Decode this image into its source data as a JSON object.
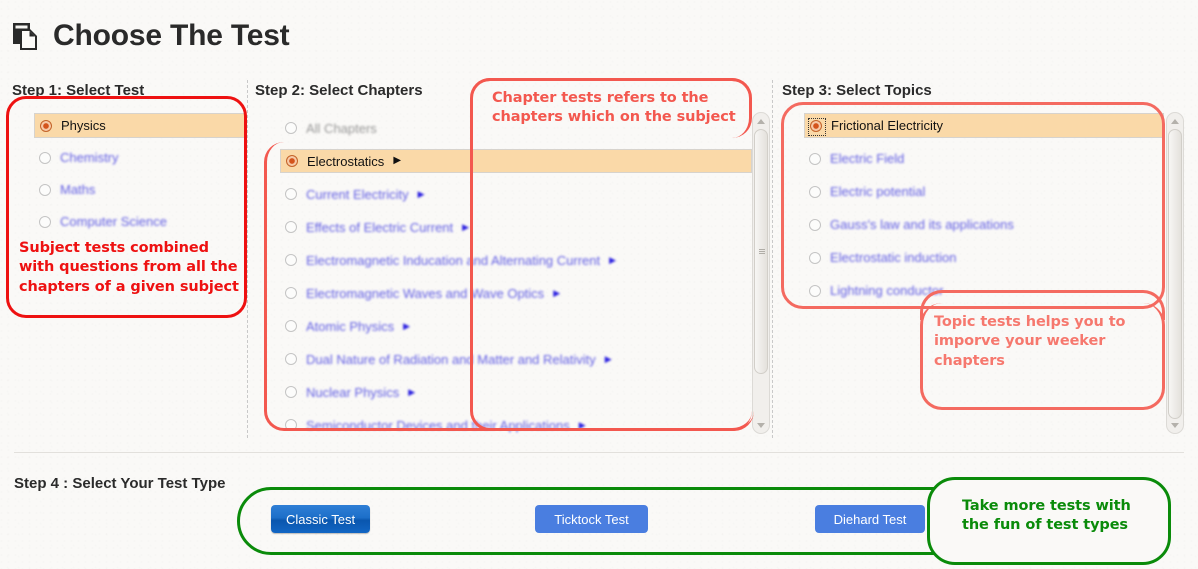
{
  "header": {
    "title": "Choose The Test",
    "icon": "pages-icon"
  },
  "steps": {
    "step1_label": "Step 1: Select Test",
    "step2_label": "Step 2: Select Chapters",
    "step3_label": "Step 3: Select Topics",
    "step4_label": "Step 4 : Select Your Test Type"
  },
  "subjects": [
    {
      "label": "Physics",
      "selected": true,
      "muted": true
    },
    {
      "label": "Chemistry",
      "selected": false,
      "muted": true
    },
    {
      "label": "Maths",
      "selected": false,
      "muted": true
    },
    {
      "label": "Computer Science",
      "selected": false,
      "muted": true
    }
  ],
  "chapters": [
    {
      "label": "All Chapters",
      "selected": false,
      "gray": true,
      "arrow": false
    },
    {
      "label": "Electrostatics",
      "selected": true,
      "arrow": true
    },
    {
      "label": "Current Electricity",
      "selected": false,
      "arrow": true
    },
    {
      "label": "Effects of Electric Current",
      "selected": false,
      "arrow": true
    },
    {
      "label": "Electromagnetic Inducation and Alternating Current",
      "selected": false,
      "arrow": true
    },
    {
      "label": "Electromagnetic Waves and Wave Optics",
      "selected": false,
      "arrow": true
    },
    {
      "label": "Atomic Physics",
      "selected": false,
      "arrow": true
    },
    {
      "label": "Dual Nature of Radiation and Matter and Relativity",
      "selected": false,
      "arrow": true
    },
    {
      "label": "Nuclear Physics",
      "selected": false,
      "arrow": true
    },
    {
      "label": "Semiconductor Devices and their Applications",
      "selected": false,
      "arrow": true
    }
  ],
  "topics": [
    {
      "label": "Frictional Electricity",
      "selected": true
    },
    {
      "label": "Electric Field",
      "selected": false
    },
    {
      "label": "Electric potential",
      "selected": false
    },
    {
      "label": "Gauss's law and its applications",
      "selected": false
    },
    {
      "label": "Electrostatic induction",
      "selected": false
    },
    {
      "label": "Lightning conductor",
      "selected": false
    }
  ],
  "test_types": [
    {
      "label": "Classic Test",
      "style": "primary"
    },
    {
      "label": "Ticktock Test",
      "style": "secondary"
    },
    {
      "label": "Diehard Test",
      "style": "secondary"
    }
  ],
  "annotations": {
    "subject": "Subject tests combined\nwith questions from all the\nchapters of a given subject",
    "chapter": "Chapter tests refers to the\nchapters which on the subject",
    "topic": "Topic tests helps you to\nimporve your weeker\nchapters",
    "testtype": "Take more tests with\nthe fun of test types"
  },
  "colors": {
    "annotation_red": "#ee1111",
    "annotation_salmon": "#f3584f",
    "annotation_coral": "#f46a60",
    "annotation_green": "#0a8b0a",
    "selected_row": "#fad9a8",
    "link_blue": "#4b47e0",
    "button_primary": "#1d6fc9",
    "button_secondary": "#4a7ee0"
  },
  "scrollbars": {
    "chapters": {
      "arrow_up": "▲",
      "arrow_down": "▼"
    },
    "topics": {
      "arrow_up": "▲",
      "arrow_down": "▼"
    }
  }
}
